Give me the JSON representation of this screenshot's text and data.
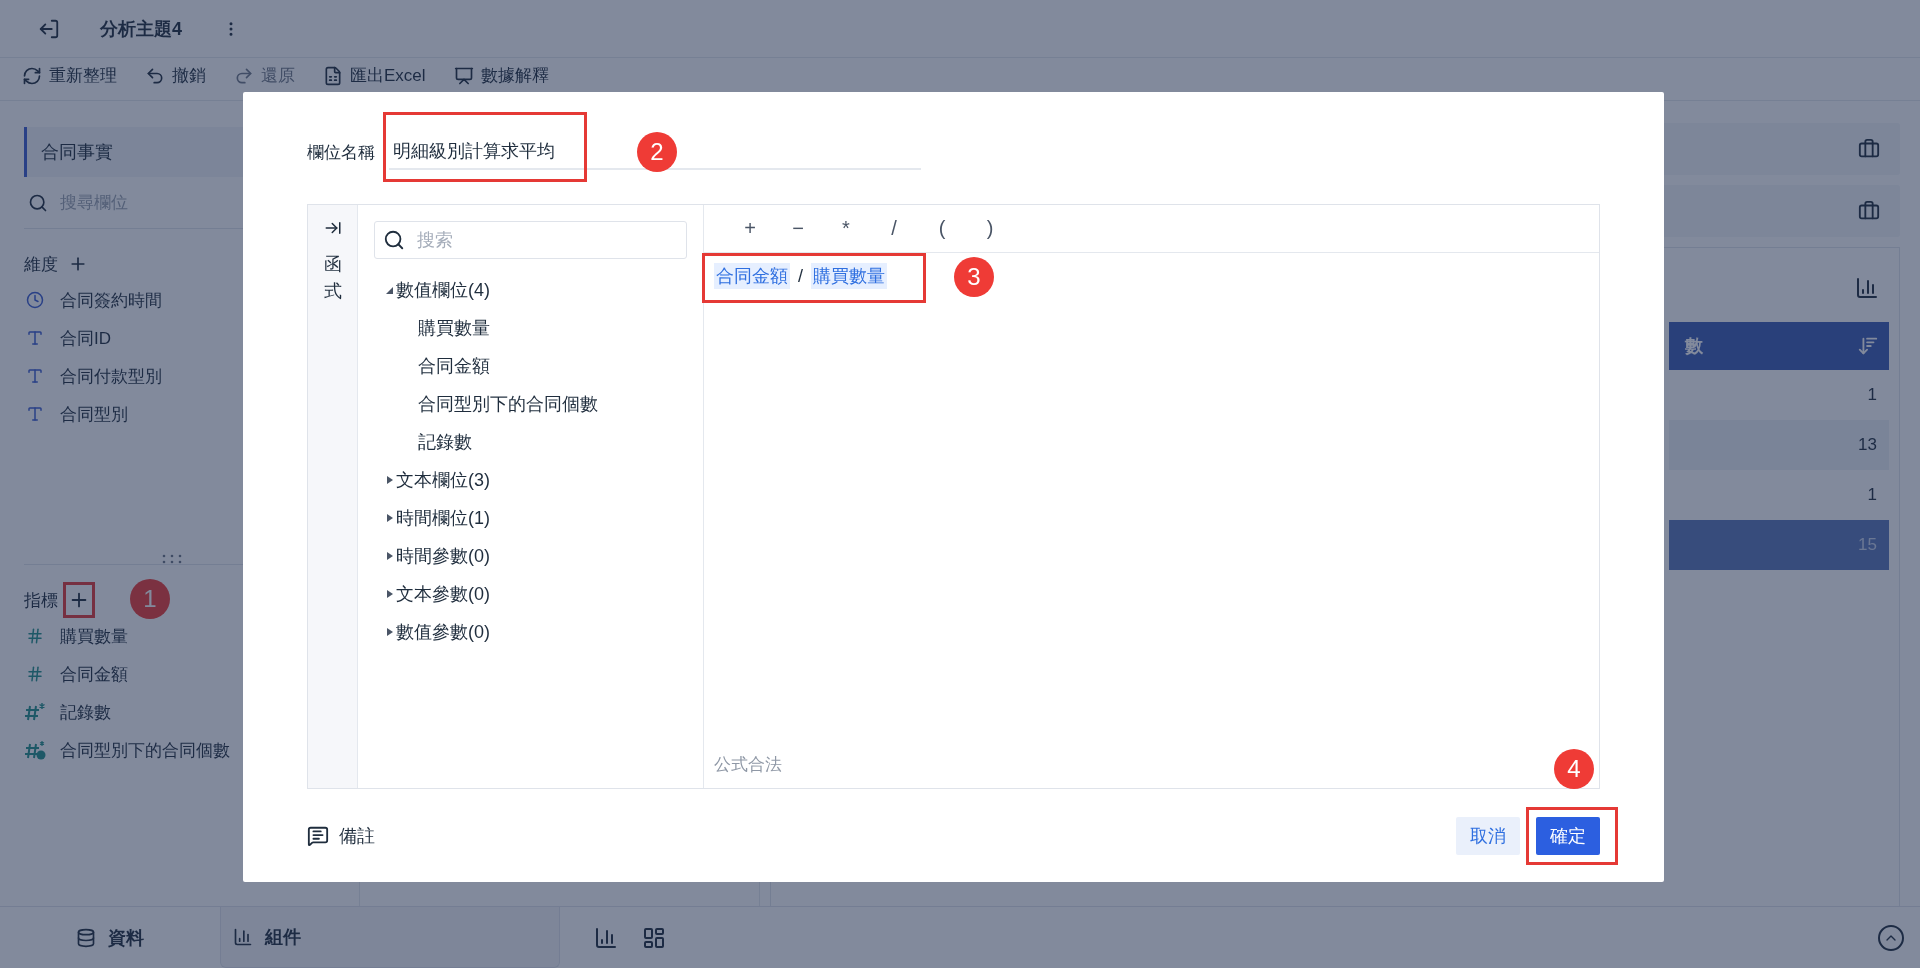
{
  "top_bar": {
    "title": "分析主題4"
  },
  "toolbar": [
    {
      "label": "重新整理",
      "kind": "refresh",
      "disabled": false
    },
    {
      "label": "撤銷",
      "kind": "undo",
      "disabled": false
    },
    {
      "label": "還原",
      "kind": "redo",
      "disabled": true
    },
    {
      "label": "匯出Excel",
      "kind": "excel",
      "disabled": false
    },
    {
      "label": "數據解釋",
      "kind": "explain",
      "disabled": false
    }
  ],
  "sidebar": {
    "dataset": "合同事實",
    "search_placeholder": "搜尋欄位",
    "dimensions": {
      "title": "維度",
      "items": [
        {
          "label": "合同簽約時間",
          "kind": "time"
        },
        {
          "label": "合同ID",
          "kind": "text"
        },
        {
          "label": "合同付款型別",
          "kind": "text"
        },
        {
          "label": "合同型別",
          "kind": "text"
        }
      ]
    },
    "measures": {
      "title": "指標",
      "items": [
        {
          "label": "購買數量",
          "kind": "number"
        },
        {
          "label": "合同金額",
          "kind": "number"
        },
        {
          "label": "記錄數",
          "kind": "count"
        },
        {
          "label": "合同型別下的合同個數",
          "kind": "calc"
        }
      ]
    }
  },
  "table": {
    "header": "數",
    "rows": [
      {
        "value": "1",
        "selected": false
      },
      {
        "value": "13",
        "selected": false
      },
      {
        "value": "1",
        "selected": false
      },
      {
        "value": "15",
        "selected": true
      }
    ]
  },
  "dialog": {
    "name_label": "欄位名稱",
    "name_value": "明細級別計算求平均",
    "side_tab": "函式",
    "search_placeholder": "搜索",
    "tree": [
      {
        "label": "數值欄位(4)",
        "expanded": true,
        "children": [
          {
            "label": "購買數量"
          },
          {
            "label": "合同金額"
          },
          {
            "label": "合同型別下的合同個數"
          },
          {
            "label": "記錄數"
          }
        ]
      },
      {
        "label": "文本欄位(3)",
        "expanded": false
      },
      {
        "label": "時間欄位(1)",
        "expanded": false
      },
      {
        "label": "時間參數(0)",
        "expanded": false
      },
      {
        "label": "文本參數(0)",
        "expanded": false
      },
      {
        "label": "數值參數(0)",
        "expanded": false
      }
    ],
    "operators": [
      "+",
      "−",
      "*",
      "/",
      "(",
      ")"
    ],
    "formula": [
      {
        "kind": "field",
        "text": "合同金額"
      },
      {
        "kind": "op",
        "text": "/"
      },
      {
        "kind": "field",
        "text": "購買數量"
      }
    ],
    "status": "公式合法",
    "note": "備註",
    "buttons": [
      {
        "label": "取消",
        "kind": "secondary"
      },
      {
        "label": "確定",
        "kind": "primary"
      }
    ]
  },
  "annotations": [
    "1",
    "2",
    "3",
    "4"
  ],
  "bottom_bar": {
    "tabs": [
      {
        "label": "資料",
        "kind": "data",
        "selected": false
      },
      {
        "label": "組件",
        "kind": "chart",
        "selected": true
      }
    ]
  }
}
